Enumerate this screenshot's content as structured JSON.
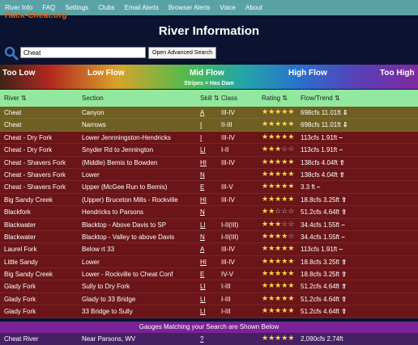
{
  "nav": [
    "River Info",
    "FAQ",
    "Settings",
    "Clubs",
    "Email Alerts",
    "Browser Alerts",
    "Voice",
    "About"
  ],
  "watermark": "Hack-Cheat.org",
  "title": "River Information",
  "search": {
    "value": "Cheat",
    "button": "Open Advanced Search"
  },
  "legend": {
    "too_low": "Too Low",
    "low": "Low Flow",
    "mid": "Mid Flow",
    "high": "High Flow",
    "too_high": "Too High",
    "stripes": "Stripes = Has Dam"
  },
  "headers": {
    "river": "River ⇅",
    "section": "Section",
    "skill": "Skill ⇅",
    "class": "Class",
    "rating": "Rating ⇅",
    "flow": "Flow/Trend ⇅"
  },
  "rows": [
    {
      "river": "Cheat",
      "section": "Canyon",
      "skill": "A",
      "class": "III-IV",
      "stars": 5,
      "flow": "698cfs 11.01ft",
      "trend": "down",
      "color": "#6f5f22"
    },
    {
      "river": "Cheat",
      "section": "Narrows",
      "skill": "I",
      "class": "II-III",
      "stars": 5,
      "flow": "698cfs 11.01ft",
      "trend": "down",
      "color": "#6f5f22"
    },
    {
      "river": "Cheat - Dry Fork",
      "section": "Lower Jennningston-Hendricks",
      "skill": "I",
      "class": "III-IV",
      "stars": 5,
      "flow": "113cfs 1.91ft",
      "trend": "flat",
      "color": "#6b1518"
    },
    {
      "river": "Cheat - Dry Fork",
      "section": "Snyder Rd to Jennington",
      "skill": "LI",
      "class": "I-II",
      "stars": 3,
      "flow": "113cfs 1.91ft",
      "trend": "flat",
      "color": "#6b1518"
    },
    {
      "river": "Cheat - Shavers Fork",
      "section": "(Middle) Bemis to Bowden",
      "skill": "HI",
      "class": "III-IV",
      "stars": 5,
      "flow": "138cfs 4.04ft",
      "trend": "up",
      "color": "#6b1518"
    },
    {
      "river": "Cheat - Shavers Fork",
      "section": "Lower",
      "skill": "N",
      "class": "",
      "stars": 5,
      "flow": "138cfs 4.04ft",
      "trend": "up",
      "color": "#6b1518"
    },
    {
      "river": "Cheat - Shavers Fork",
      "section": "Upper (McGee Run to Bemis)",
      "skill": "E",
      "class": "III-V",
      "stars": 5,
      "flow": "3.3 ft",
      "trend": "flat",
      "color": "#6b1518"
    },
    {
      "river": "Big Sandy Creek",
      "section": "(Upper) Bruceton Mills - Rockville",
      "skill": "HI",
      "class": "III-IV",
      "stars": 5,
      "flow": "18.8cfs 3.25ft",
      "trend": "up",
      "color": "#6b1518"
    },
    {
      "river": "Blackfork",
      "section": "Hendricks to Parsons",
      "skill": "N",
      "class": "",
      "stars": 2,
      "flow": "51.2cfs 4.64ft",
      "trend": "up",
      "color": "#6b1518"
    },
    {
      "river": "Blackwater",
      "section": "Blacktop - Above Davis to SP",
      "skill": "LI",
      "class": "I-II(III)",
      "stars": 3,
      "flow": "34.4cfs 1.55ft",
      "trend": "flat",
      "color": "#6b1518"
    },
    {
      "river": "Blackwater",
      "section": "Blacktop - Valley to above Davis",
      "skill": "N",
      "class": "I-II(III)",
      "stars": 4,
      "flow": "34.4cfs 1.55ft",
      "trend": "flat",
      "color": "#6b1518"
    },
    {
      "river": "Laurel Fork",
      "section": "Below rt 33",
      "skill": "A",
      "class": "III-IV",
      "stars": 5,
      "flow": "113cfs 1.91ft",
      "trend": "flat",
      "color": "#6b1518"
    },
    {
      "river": "Little Sandy",
      "section": "Lower",
      "skill": "HI",
      "class": "III-IV",
      "stars": 5,
      "flow": "18.8cfs 3.25ft",
      "trend": "up",
      "color": "#6b1518"
    },
    {
      "river": "Big Sandy Creek",
      "section": "Lower - Rockville to Cheat Conf",
      "skill": "E",
      "class": "IV-V",
      "stars": 5,
      "flow": "18.8cfs 3.25ft",
      "trend": "up",
      "color": "#6b1518"
    },
    {
      "river": "Glady Fork",
      "section": "Sully to Dry Fork",
      "skill": "LI",
      "class": "I-III",
      "stars": 5,
      "flow": "51.2cfs 4.64ft",
      "trend": "up",
      "color": "#6b1518"
    },
    {
      "river": "Glady Fork",
      "section": "Glady to 33 Bridge",
      "skill": "LI",
      "class": "I-III",
      "stars": 5,
      "flow": "51.2cfs 4.64ft",
      "trend": "up",
      "color": "#6b1518"
    },
    {
      "river": "Glady Fork",
      "section": "33 Bridge to Sully",
      "skill": "LI",
      "class": "I-III",
      "stars": 5,
      "flow": "51.2cfs 4.64ft",
      "trend": "up",
      "color": "#6b1518"
    }
  ],
  "gauges_banner": "Gauges Matching your Search are Shown Below",
  "gauge_row": {
    "river": "Cheat River",
    "section": "Near Parsons, WV",
    "skill": "?",
    "flow": "2.74ft",
    "trend": "up",
    "stars": 5,
    "flow_full": "2,090cfs 2.74ft"
  }
}
